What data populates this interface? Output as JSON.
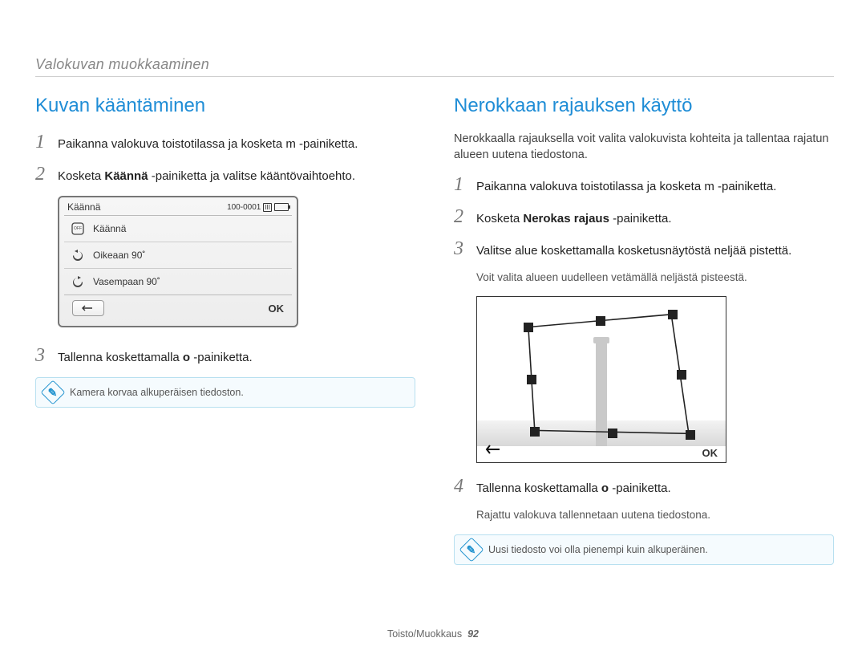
{
  "section_header": "Valokuvan muokkaaminen",
  "left": {
    "title": "Kuvan kääntäminen",
    "steps": {
      "s1": "Paikanna valokuva toistotilassa ja kosketa m -painiketta.",
      "s2_pre": "Kosketa ",
      "s2_bold": "Käännä",
      "s2_post": " -painiketta ja valitse kääntövaihtoehto.",
      "s3_pre": "Tallenna koskettamalla ",
      "s3_bold": "o",
      "s3_post": " -painiketta."
    },
    "ui": {
      "title": "Käännä",
      "counter": "100-0001",
      "items": [
        "Käännä",
        "Oikeaan 90˚",
        "Vasempaan 90˚"
      ],
      "ok": "OK"
    },
    "info": "Kamera korvaa alkuperäisen tiedoston."
  },
  "right": {
    "title": "Nerokkaan rajauksen käyttö",
    "intro": "Nerokkaalla rajauksella voit valita valokuvista kohteita ja tallentaa rajatun alueen uutena tiedostona.",
    "steps": {
      "s1": "Paikanna valokuva toistotilassa ja kosketa m -painiketta.",
      "s2_pre": "Kosketa ",
      "s2_bold": "Nerokas rajaus",
      "s2_post": " -painiketta.",
      "s3": "Valitse alue koskettamalla kosketusnäytöstä neljää pistettä.",
      "s3_sub": "Voit valita alueen uudelleen vetämällä neljästä pisteestä.",
      "s4_pre": "Tallenna koskettamalla ",
      "s4_bold": "o",
      "s4_post": " -painiketta.",
      "s4_sub": "Rajattu valokuva tallennetaan uutena tiedostona."
    },
    "crop_ok": "OK",
    "info": "Uusi tiedosto voi olla pienempi kuin alkuperäinen."
  },
  "footer": {
    "text": "Toisto/Muokkaus",
    "page": "92"
  }
}
